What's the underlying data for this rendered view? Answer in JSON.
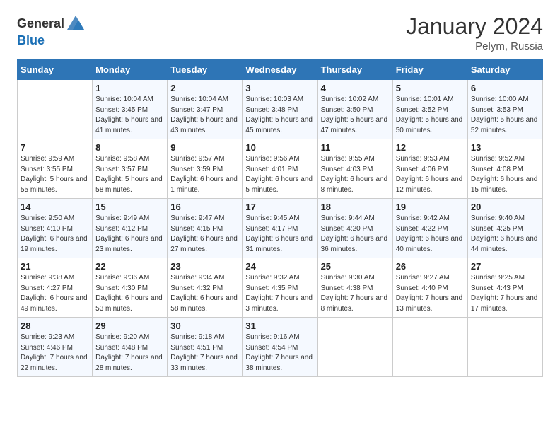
{
  "header": {
    "logo_general": "General",
    "logo_blue": "Blue",
    "month": "January 2024",
    "location": "Pelym, Russia"
  },
  "weekdays": [
    "Sunday",
    "Monday",
    "Tuesday",
    "Wednesday",
    "Thursday",
    "Friday",
    "Saturday"
  ],
  "weeks": [
    [
      {
        "day": "",
        "sunrise": "",
        "sunset": "",
        "daylight": ""
      },
      {
        "day": "1",
        "sunrise": "Sunrise: 10:04 AM",
        "sunset": "Sunset: 3:45 PM",
        "daylight": "Daylight: 5 hours and 41 minutes."
      },
      {
        "day": "2",
        "sunrise": "Sunrise: 10:04 AM",
        "sunset": "Sunset: 3:47 PM",
        "daylight": "Daylight: 5 hours and 43 minutes."
      },
      {
        "day": "3",
        "sunrise": "Sunrise: 10:03 AM",
        "sunset": "Sunset: 3:48 PM",
        "daylight": "Daylight: 5 hours and 45 minutes."
      },
      {
        "day": "4",
        "sunrise": "Sunrise: 10:02 AM",
        "sunset": "Sunset: 3:50 PM",
        "daylight": "Daylight: 5 hours and 47 minutes."
      },
      {
        "day": "5",
        "sunrise": "Sunrise: 10:01 AM",
        "sunset": "Sunset: 3:52 PM",
        "daylight": "Daylight: 5 hours and 50 minutes."
      },
      {
        "day": "6",
        "sunrise": "Sunrise: 10:00 AM",
        "sunset": "Sunset: 3:53 PM",
        "daylight": "Daylight: 5 hours and 52 minutes."
      }
    ],
    [
      {
        "day": "7",
        "sunrise": "Sunrise: 9:59 AM",
        "sunset": "Sunset: 3:55 PM",
        "daylight": "Daylight: 5 hours and 55 minutes."
      },
      {
        "day": "8",
        "sunrise": "Sunrise: 9:58 AM",
        "sunset": "Sunset: 3:57 PM",
        "daylight": "Daylight: 5 hours and 58 minutes."
      },
      {
        "day": "9",
        "sunrise": "Sunrise: 9:57 AM",
        "sunset": "Sunset: 3:59 PM",
        "daylight": "Daylight: 6 hours and 1 minute."
      },
      {
        "day": "10",
        "sunrise": "Sunrise: 9:56 AM",
        "sunset": "Sunset: 4:01 PM",
        "daylight": "Daylight: 6 hours and 5 minutes."
      },
      {
        "day": "11",
        "sunrise": "Sunrise: 9:55 AM",
        "sunset": "Sunset: 4:03 PM",
        "daylight": "Daylight: 6 hours and 8 minutes."
      },
      {
        "day": "12",
        "sunrise": "Sunrise: 9:53 AM",
        "sunset": "Sunset: 4:06 PM",
        "daylight": "Daylight: 6 hours and 12 minutes."
      },
      {
        "day": "13",
        "sunrise": "Sunrise: 9:52 AM",
        "sunset": "Sunset: 4:08 PM",
        "daylight": "Daylight: 6 hours and 15 minutes."
      }
    ],
    [
      {
        "day": "14",
        "sunrise": "Sunrise: 9:50 AM",
        "sunset": "Sunset: 4:10 PM",
        "daylight": "Daylight: 6 hours and 19 minutes."
      },
      {
        "day": "15",
        "sunrise": "Sunrise: 9:49 AM",
        "sunset": "Sunset: 4:12 PM",
        "daylight": "Daylight: 6 hours and 23 minutes."
      },
      {
        "day": "16",
        "sunrise": "Sunrise: 9:47 AM",
        "sunset": "Sunset: 4:15 PM",
        "daylight": "Daylight: 6 hours and 27 minutes."
      },
      {
        "day": "17",
        "sunrise": "Sunrise: 9:45 AM",
        "sunset": "Sunset: 4:17 PM",
        "daylight": "Daylight: 6 hours and 31 minutes."
      },
      {
        "day": "18",
        "sunrise": "Sunrise: 9:44 AM",
        "sunset": "Sunset: 4:20 PM",
        "daylight": "Daylight: 6 hours and 36 minutes."
      },
      {
        "day": "19",
        "sunrise": "Sunrise: 9:42 AM",
        "sunset": "Sunset: 4:22 PM",
        "daylight": "Daylight: 6 hours and 40 minutes."
      },
      {
        "day": "20",
        "sunrise": "Sunrise: 9:40 AM",
        "sunset": "Sunset: 4:25 PM",
        "daylight": "Daylight: 6 hours and 44 minutes."
      }
    ],
    [
      {
        "day": "21",
        "sunrise": "Sunrise: 9:38 AM",
        "sunset": "Sunset: 4:27 PM",
        "daylight": "Daylight: 6 hours and 49 minutes."
      },
      {
        "day": "22",
        "sunrise": "Sunrise: 9:36 AM",
        "sunset": "Sunset: 4:30 PM",
        "daylight": "Daylight: 6 hours and 53 minutes."
      },
      {
        "day": "23",
        "sunrise": "Sunrise: 9:34 AM",
        "sunset": "Sunset: 4:32 PM",
        "daylight": "Daylight: 6 hours and 58 minutes."
      },
      {
        "day": "24",
        "sunrise": "Sunrise: 9:32 AM",
        "sunset": "Sunset: 4:35 PM",
        "daylight": "Daylight: 7 hours and 3 minutes."
      },
      {
        "day": "25",
        "sunrise": "Sunrise: 9:30 AM",
        "sunset": "Sunset: 4:38 PM",
        "daylight": "Daylight: 7 hours and 8 minutes."
      },
      {
        "day": "26",
        "sunrise": "Sunrise: 9:27 AM",
        "sunset": "Sunset: 4:40 PM",
        "daylight": "Daylight: 7 hours and 13 minutes."
      },
      {
        "day": "27",
        "sunrise": "Sunrise: 9:25 AM",
        "sunset": "Sunset: 4:43 PM",
        "daylight": "Daylight: 7 hours and 17 minutes."
      }
    ],
    [
      {
        "day": "28",
        "sunrise": "Sunrise: 9:23 AM",
        "sunset": "Sunset: 4:46 PM",
        "daylight": "Daylight: 7 hours and 22 minutes."
      },
      {
        "day": "29",
        "sunrise": "Sunrise: 9:20 AM",
        "sunset": "Sunset: 4:48 PM",
        "daylight": "Daylight: 7 hours and 28 minutes."
      },
      {
        "day": "30",
        "sunrise": "Sunrise: 9:18 AM",
        "sunset": "Sunset: 4:51 PM",
        "daylight": "Daylight: 7 hours and 33 minutes."
      },
      {
        "day": "31",
        "sunrise": "Sunrise: 9:16 AM",
        "sunset": "Sunset: 4:54 PM",
        "daylight": "Daylight: 7 hours and 38 minutes."
      },
      {
        "day": "",
        "sunrise": "",
        "sunset": "",
        "daylight": ""
      },
      {
        "day": "",
        "sunrise": "",
        "sunset": "",
        "daylight": ""
      },
      {
        "day": "",
        "sunrise": "",
        "sunset": "",
        "daylight": ""
      }
    ]
  ]
}
